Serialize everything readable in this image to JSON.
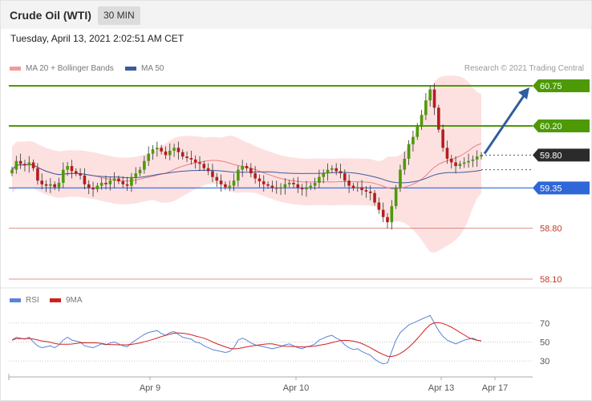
{
  "header": {
    "title": "Crude Oil (WTI)",
    "timeframe": "30 MIN",
    "datetime": "Tuesday, April 13, 2021 2:02:51 AM CET"
  },
  "legend": {
    "ma20_label": "MA 20 + Bollinger Bands",
    "ma50_label": "MA 50",
    "rsi_label": "RSI",
    "ma9_label": "9MA"
  },
  "credit": "Research © 2021 Trading Central",
  "colors": {
    "resistance": "#4e9a06",
    "pivot": "#2f67d8",
    "support": "#c0392b",
    "current": "#2b2b2b",
    "candle_up": "#4e9a06",
    "candle_down": "#b71c1c",
    "bollinger": "#fddcdc",
    "ma20": "#e88080",
    "ma50": "#3a5b9e",
    "rsi": "#5b84d6",
    "rsi_ma": "#d02020",
    "arrow": "#2e5e9e"
  },
  "chart_data": [
    {
      "type": "candlestick",
      "levels": [
        {
          "value": "60.75",
          "kind": "resistance"
        },
        {
          "value": "60.20",
          "kind": "resistance"
        },
        {
          "value": "59.80",
          "kind": "current"
        },
        {
          "value": "59.35",
          "kind": "pivot"
        },
        {
          "value": "58.80",
          "kind": "support"
        },
        {
          "value": "58.10",
          "kind": "support"
        }
      ],
      "x_ticks": [
        "Apr 9",
        "Apr 10",
        "Apr 13",
        "Apr 17"
      ],
      "ylim": [
        58.1,
        60.75
      ],
      "series_close": [
        59.6,
        59.72,
        59.68,
        59.66,
        59.7,
        59.62,
        59.45,
        59.4,
        59.38,
        59.4,
        59.36,
        59.42,
        59.6,
        59.65,
        59.58,
        59.55,
        59.52,
        59.4,
        59.35,
        59.33,
        59.38,
        59.42,
        59.4,
        59.45,
        59.48,
        59.44,
        59.4,
        59.38,
        59.5,
        59.55,
        59.6,
        59.72,
        59.82,
        59.88,
        59.9,
        59.85,
        59.8,
        59.86,
        59.9,
        59.84,
        59.78,
        59.76,
        59.74,
        59.7,
        59.68,
        59.62,
        59.58,
        59.5,
        59.45,
        59.4,
        59.36,
        59.38,
        59.45,
        59.6,
        59.65,
        59.62,
        59.55,
        59.48,
        59.44,
        59.4,
        59.38,
        59.35,
        59.34,
        59.36,
        59.4,
        59.42,
        59.4,
        59.35,
        59.33,
        59.36,
        59.38,
        59.42,
        59.5,
        59.55,
        59.6,
        59.62,
        59.58,
        59.55,
        59.45,
        59.38,
        59.35,
        59.36,
        59.32,
        59.3,
        59.28,
        59.15,
        59.05,
        58.95,
        58.88,
        59.1,
        59.35,
        59.6,
        59.75,
        59.95,
        60.05,
        60.2,
        60.35,
        60.55,
        60.7,
        60.45,
        60.15,
        59.9,
        59.75,
        59.7,
        59.65,
        59.68,
        59.7,
        59.72,
        59.74,
        59.78,
        59.8
      ],
      "series_rsi": [
        52,
        55,
        54,
        53,
        55,
        50,
        46,
        44,
        45,
        46,
        44,
        47,
        52,
        55,
        52,
        51,
        50,
        46,
        45,
        44,
        46,
        48,
        47,
        49,
        50,
        48,
        46,
        45,
        49,
        52,
        55,
        58,
        60,
        61,
        62,
        59,
        57,
        60,
        61,
        58,
        55,
        54,
        53,
        50,
        49,
        46,
        44,
        42,
        41,
        40,
        39,
        40,
        44,
        52,
        54,
        52,
        49,
        47,
        46,
        45,
        44,
        43,
        44,
        45,
        47,
        48,
        46,
        44,
        43,
        45,
        46,
        48,
        52,
        54,
        56,
        57,
        54,
        52,
        47,
        44,
        42,
        43,
        40,
        38,
        36,
        32,
        29,
        27,
        28,
        40,
        52,
        60,
        64,
        68,
        70,
        72,
        74,
        76,
        78,
        70,
        62,
        56,
        52,
        50,
        48,
        50,
        52,
        53,
        54,
        52,
        51
      ],
      "rsi_ticks": [
        "70",
        "50",
        "30"
      ],
      "rsi_ylim": [
        20,
        85
      ]
    }
  ]
}
